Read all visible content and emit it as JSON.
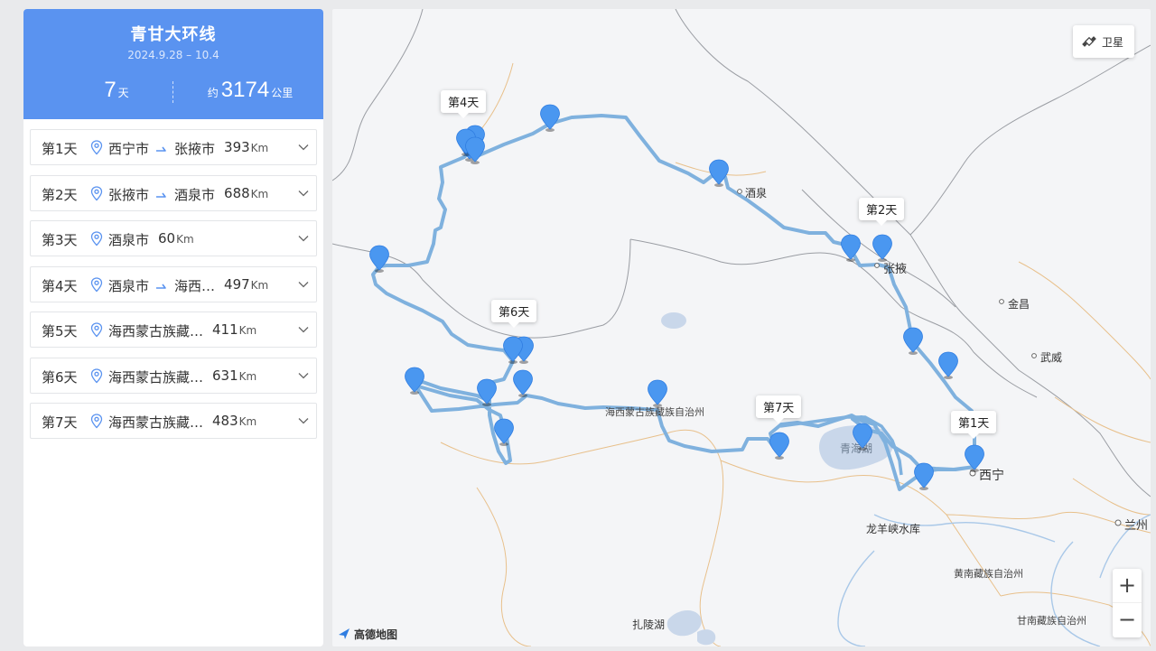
{
  "trip": {
    "title": "青甘大环线",
    "dates": "2024.9.28 – 10.4",
    "days_num": "7",
    "days_unit": "天",
    "dist_prefix": "约",
    "dist_num": "3174",
    "dist_unit": "公里"
  },
  "days": [
    {
      "label": "第1天",
      "from": "西宁市",
      "to": "张掖市",
      "distance": "393",
      "unit": "Km",
      "has_arrow": true
    },
    {
      "label": "第2天",
      "from": "张掖市",
      "to": "酒泉市",
      "distance": "688",
      "unit": "Km",
      "has_arrow": true
    },
    {
      "label": "第3天",
      "from": "酒泉市",
      "to": "",
      "distance": "60",
      "unit": "Km",
      "has_arrow": false
    },
    {
      "label": "第4天",
      "from": "酒泉市",
      "to": "海西…",
      "distance": "497",
      "unit": "Km",
      "has_arrow": true
    },
    {
      "label": "第5天",
      "from": "海西蒙古族藏…",
      "to": "",
      "distance": "411",
      "unit": "Km",
      "has_arrow": false
    },
    {
      "label": "第6天",
      "from": "海西蒙古族藏…",
      "to": "",
      "distance": "631",
      "unit": "Km",
      "has_arrow": false
    },
    {
      "label": "第7天",
      "from": "海西蒙古族藏…",
      "to": "",
      "distance": "483",
      "unit": "Km",
      "has_arrow": false
    }
  ],
  "map": {
    "satellite_label": "卫星",
    "zoom_in": "+",
    "zoom_out": "−",
    "logo_text": "高德地图",
    "labels": {
      "jiuquan": "酒泉",
      "zhangye": "张掖",
      "jinchang": "金昌",
      "wuwei": "武威",
      "xining": "西宁",
      "lanzhou": "兰州",
      "qinghaihu": "青海湖",
      "longyangxia": "龙羊峡水库",
      "haixi": "海西蒙古族藏族自治州",
      "huangnan": "黄南藏族自治州",
      "gannan": "甘南藏族自治州",
      "zhaling": "扎陵湖"
    },
    "callouts": {
      "day4": "第4天",
      "day2": "第2天",
      "day6": "第6天",
      "day7": "第7天",
      "day1": "第1天"
    },
    "route_color": "#7fb1de",
    "marker_color": "#4a97f0"
  }
}
